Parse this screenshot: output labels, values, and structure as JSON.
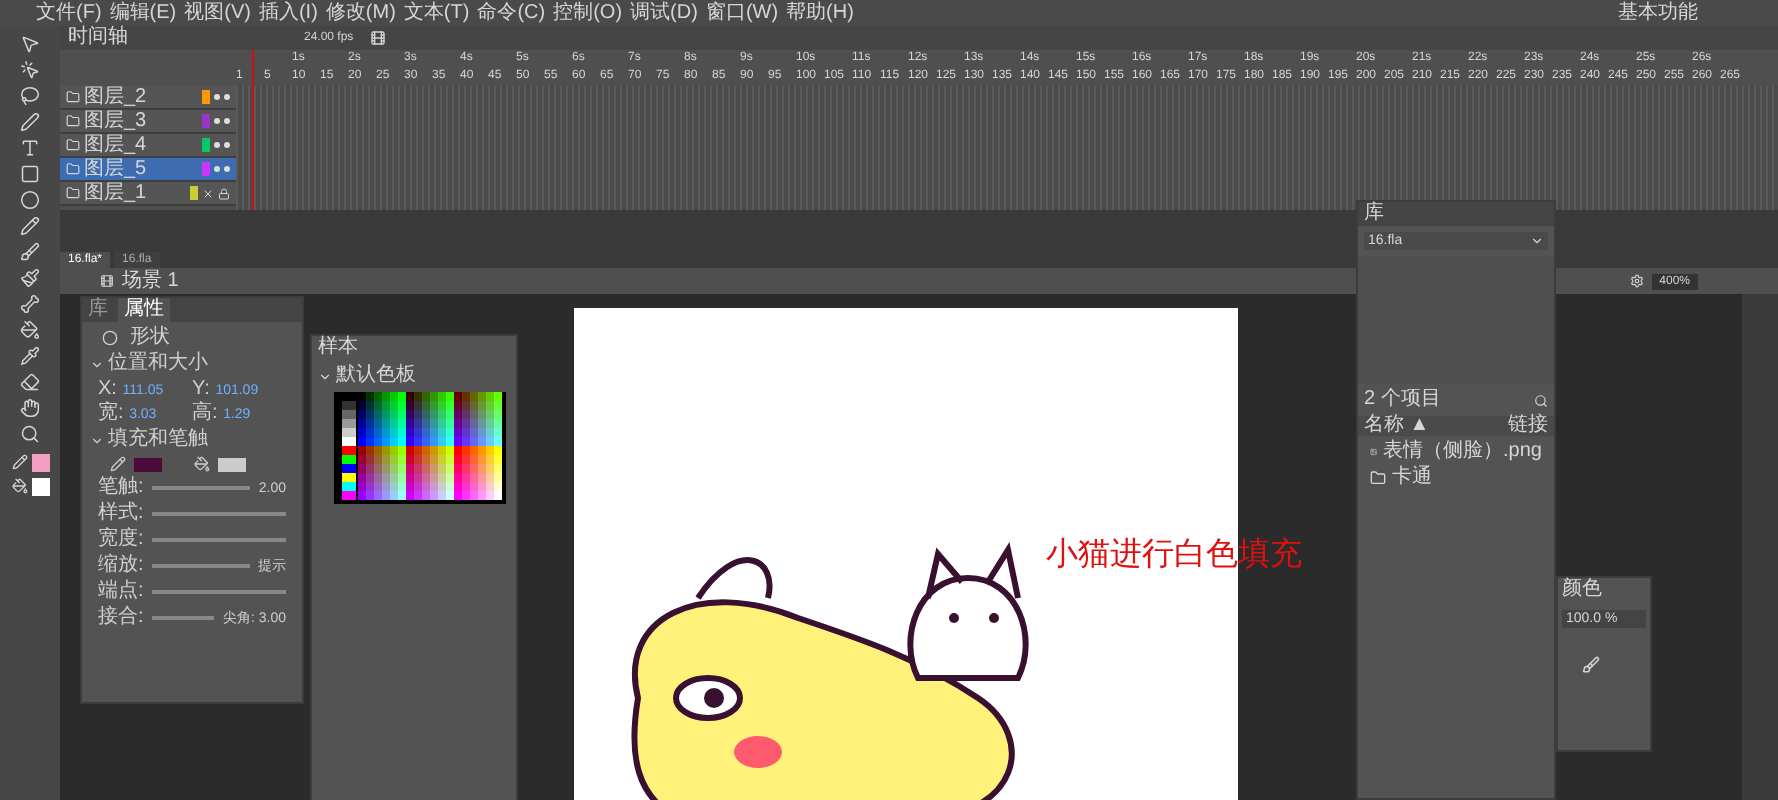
{
  "menu": [
    "文件(F)",
    "编辑(E)",
    "视图(V)",
    "插入(I)",
    "修改(M)",
    "文本(T)",
    "命令(C)",
    "控制(O)",
    "调试(D)",
    "窗口(W)",
    "帮助(H)"
  ],
  "workspace": "基本功能",
  "timeline": {
    "title": "时间轴",
    "fps": "24.00 fps",
    "seconds": [
      "1s",
      "2s",
      "3s",
      "4s",
      "5s",
      "6s",
      "7s",
      "8s",
      "9s",
      "10s",
      "11s",
      "12s",
      "13s",
      "14s",
      "15s",
      "16s",
      "17s",
      "18s",
      "19s",
      "20s",
      "21s",
      "22s",
      "23s",
      "24s",
      "25s",
      "26s"
    ],
    "frames": [
      "1",
      "5",
      "10",
      "15",
      "20",
      "25",
      "30",
      "35",
      "40",
      "45",
      "50",
      "55",
      "60",
      "65",
      "70",
      "75",
      "80",
      "85",
      "90",
      "95",
      "100",
      "105",
      "110",
      "115",
      "120",
      "125",
      "130",
      "135",
      "140",
      "145",
      "150",
      "155",
      "160",
      "165",
      "170",
      "175",
      "180",
      "185",
      "190",
      "195",
      "200",
      "205",
      "210",
      "215",
      "220",
      "225",
      "230",
      "235",
      "240",
      "245",
      "250",
      "255",
      "260",
      "265"
    ],
    "layers": [
      {
        "name": "图层_2",
        "color": "#ff9900",
        "selected": false,
        "visible": true,
        "locked": false
      },
      {
        "name": "图层_3",
        "color": "#9933cc",
        "selected": false,
        "visible": true,
        "locked": false
      },
      {
        "name": "图层_4",
        "color": "#00cc66",
        "selected": false,
        "visible": true,
        "locked": false
      },
      {
        "name": "图层_5",
        "color": "#cc33ff",
        "selected": true,
        "visible": true,
        "locked": false
      },
      {
        "name": "图层_1",
        "color": "#cccc33",
        "selected": false,
        "visible": false,
        "locked": true
      }
    ]
  },
  "documents": [
    {
      "label": "16.fla*",
      "selected": true
    },
    {
      "label": "16.fla",
      "selected": false
    }
  ],
  "scene": "场景 1",
  "zoom": "400%",
  "tools": {
    "stroke": {
      "color": "#f19ec2"
    },
    "fill": {
      "color": "#ffffff"
    }
  },
  "properties": {
    "tabs": [
      {
        "label": "库",
        "selected": false
      },
      {
        "label": "属性",
        "selected": true
      }
    ],
    "object": "形状",
    "position_title": "位置和大小",
    "fields": [
      {
        "label": "X:",
        "value": "111.05"
      },
      {
        "label": "Y:",
        "value": "101.09"
      },
      {
        "label": "宽:",
        "value": "3.03"
      },
      {
        "label": "高:",
        "value": "1.29"
      }
    ],
    "fill_title": "填充和笔触",
    "stroke": {
      "color": "#4a0a3a"
    },
    "fill": {
      "color": "#cccccc"
    },
    "rows": [
      {
        "label": "笔触:",
        "value": "2.00"
      },
      {
        "label": "样式:"
      },
      {
        "label": "宽度:"
      },
      {
        "label": "缩放:",
        "value": "提示"
      },
      {
        "label": "端点:"
      },
      {
        "label": "接合:",
        "value": "尖角: 3.00"
      }
    ]
  },
  "swatches": {
    "title": "样本",
    "groups": [
      "默认色板"
    ]
  },
  "library": {
    "title": "库",
    "document": "16.fla",
    "count": "2 个项目",
    "columns": [
      "名称 ▲",
      "链接"
    ],
    "items": [
      {
        "name": "表情（侧脸）.png",
        "kind": "bitmap"
      },
      {
        "name": "卡通",
        "kind": "folder"
      }
    ]
  },
  "color_panel": {
    "title": "颜色",
    "alpha": "100.0 %"
  },
  "annotation": "小猫进行白色填充"
}
